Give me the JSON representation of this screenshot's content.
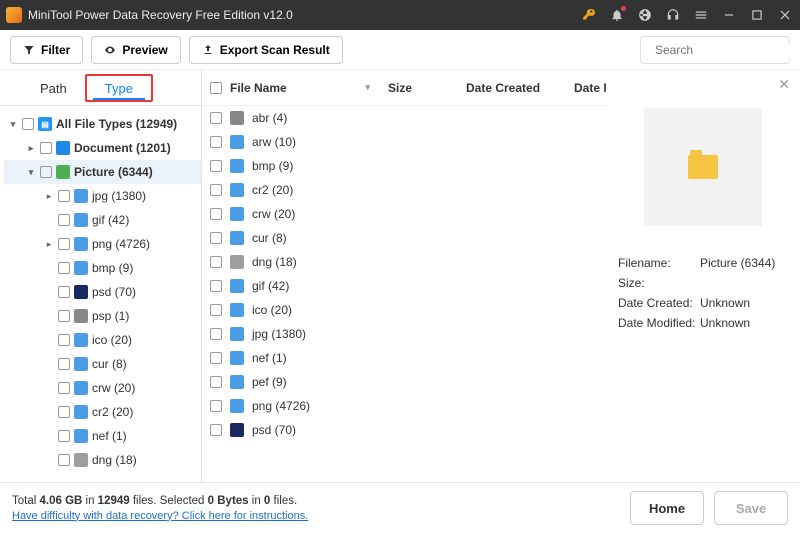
{
  "titlebar": {
    "title": "MiniTool Power Data Recovery Free Edition v12.0"
  },
  "toolbar": {
    "filter_label": "Filter",
    "preview_label": "Preview",
    "export_label": "Export Scan Result",
    "search_placeholder": "Search"
  },
  "tabs": {
    "path": "Path",
    "type": "Type"
  },
  "tree": {
    "root": "All File Types (12949)",
    "items": [
      {
        "label": "Document (1201)",
        "icon": "ic-doc",
        "indent": 1,
        "chev": "right",
        "bold": true
      },
      {
        "label": "Picture (6344)",
        "icon": "ic-pic",
        "indent": 1,
        "chev": "down",
        "bold": true,
        "selected": true
      },
      {
        "label": "jpg (1380)",
        "icon": "ic-generic",
        "indent": 2,
        "chev": "right"
      },
      {
        "label": "gif (42)",
        "icon": "ic-generic",
        "indent": 2
      },
      {
        "label": "png (4726)",
        "icon": "ic-generic",
        "indent": 2,
        "chev": "right"
      },
      {
        "label": "bmp (9)",
        "icon": "ic-generic",
        "indent": 2
      },
      {
        "label": "psd (70)",
        "icon": "ic-psd",
        "indent": 2
      },
      {
        "label": "psp (1)",
        "icon": "ic-approx",
        "indent": 2
      },
      {
        "label": "ico (20)",
        "icon": "ic-generic",
        "indent": 2
      },
      {
        "label": "cur (8)",
        "icon": "ic-generic",
        "indent": 2
      },
      {
        "label": "crw (20)",
        "icon": "ic-generic",
        "indent": 2
      },
      {
        "label": "cr2 (20)",
        "icon": "ic-generic",
        "indent": 2
      },
      {
        "label": "nef (1)",
        "icon": "ic-generic",
        "indent": 2
      },
      {
        "label": "dng (18)",
        "icon": "ic-target",
        "indent": 2
      }
    ]
  },
  "file_columns": {
    "name": "File Name",
    "size": "Size",
    "dc": "Date Created",
    "dm": "Date Modif"
  },
  "files": [
    {
      "label": "abr (4)",
      "icon": "ic-approx"
    },
    {
      "label": "arw (10)",
      "icon": "ic-generic"
    },
    {
      "label": "bmp (9)",
      "icon": "ic-generic"
    },
    {
      "label": "cr2 (20)",
      "icon": "ic-generic"
    },
    {
      "label": "crw (20)",
      "icon": "ic-generic"
    },
    {
      "label": "cur (8)",
      "icon": "ic-generic"
    },
    {
      "label": "dng (18)",
      "icon": "ic-target"
    },
    {
      "label": "gif (42)",
      "icon": "ic-generic"
    },
    {
      "label": "ico (20)",
      "icon": "ic-generic"
    },
    {
      "label": "jpg (1380)",
      "icon": "ic-generic"
    },
    {
      "label": "nef (1)",
      "icon": "ic-generic"
    },
    {
      "label": "pef (9)",
      "icon": "ic-generic"
    },
    {
      "label": "png (4726)",
      "icon": "ic-generic"
    },
    {
      "label": "psd (70)",
      "icon": "ic-psd"
    }
  ],
  "preview": {
    "filename_lab": "Filename:",
    "filename": "Picture (6344)",
    "size_lab": "Size:",
    "size": "",
    "dc_lab": "Date Created:",
    "dc": "Unknown",
    "dm_lab": "Date Modified:",
    "dm": "Unknown"
  },
  "footer": {
    "total_pre": "Total ",
    "total_size": "4.06 GB",
    "in": " in ",
    "total_count": "12949",
    "files": " files.",
    "sel_pre": "  Selected ",
    "sel_size": "0 Bytes",
    "sel_in": " in ",
    "sel_count": "0",
    "sel_files": " files.",
    "link": "Have difficulty with data recovery? Click here for instructions.",
    "home": "Home",
    "save": "Save"
  }
}
